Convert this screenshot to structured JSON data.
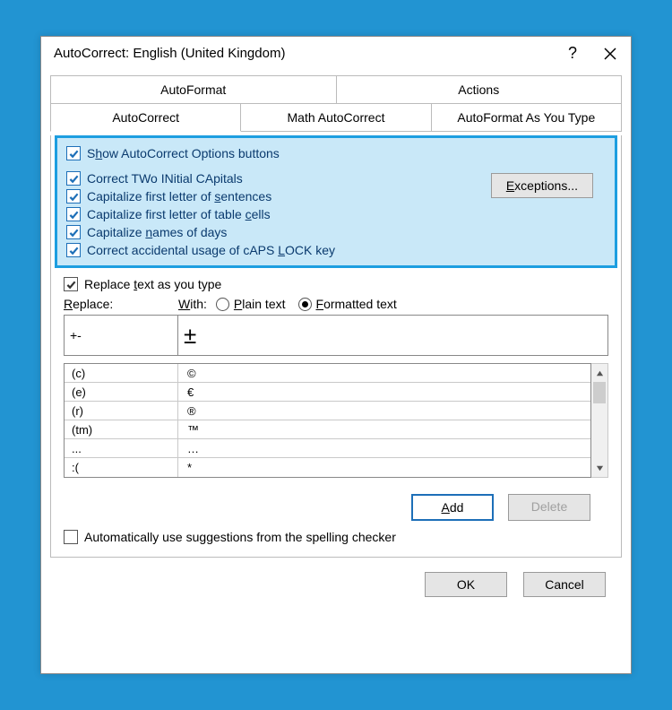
{
  "window": {
    "title": "AutoCorrect: English (United Kingdom)"
  },
  "tabs_row1": {
    "autoformat": "AutoFormat",
    "actions": "Actions"
  },
  "tabs_row2": {
    "autocorrect": "AutoCorrect",
    "math": "Math AutoCorrect",
    "asyoutype": "AutoFormat As You Type"
  },
  "options": {
    "show_buttons": "Show AutoCorrect Options buttons",
    "two_caps": "Correct TWo INitial CApitals",
    "cap_sentences": "Capitalize first letter of sentences",
    "cap_cells": "Capitalize first letter of table cells",
    "cap_days": "Capitalize names of days",
    "caps_lock": "Correct accidental usage of cAPS LOCK key"
  },
  "exceptions_label": "Exceptions...",
  "replace": {
    "header": "Replace text as you type",
    "replace_label": "Replace:",
    "with_label": "With:",
    "plain_label": "Plain text",
    "formatted_label": "Formatted text",
    "replace_value": "+-",
    "with_value": "±"
  },
  "entries": [
    {
      "from": "(c)",
      "to": "©"
    },
    {
      "from": "(e)",
      "to": "€"
    },
    {
      "from": "(r)",
      "to": "®"
    },
    {
      "from": "(tm)",
      "to": "™"
    },
    {
      "from": "...",
      "to": "…"
    },
    {
      "from": ":(",
      "to": "*"
    }
  ],
  "buttons": {
    "add": "Add",
    "delete": "Delete",
    "ok": "OK",
    "cancel": "Cancel"
  },
  "suggestion_checkbox": "Automatically use suggestions from the spelling checker"
}
